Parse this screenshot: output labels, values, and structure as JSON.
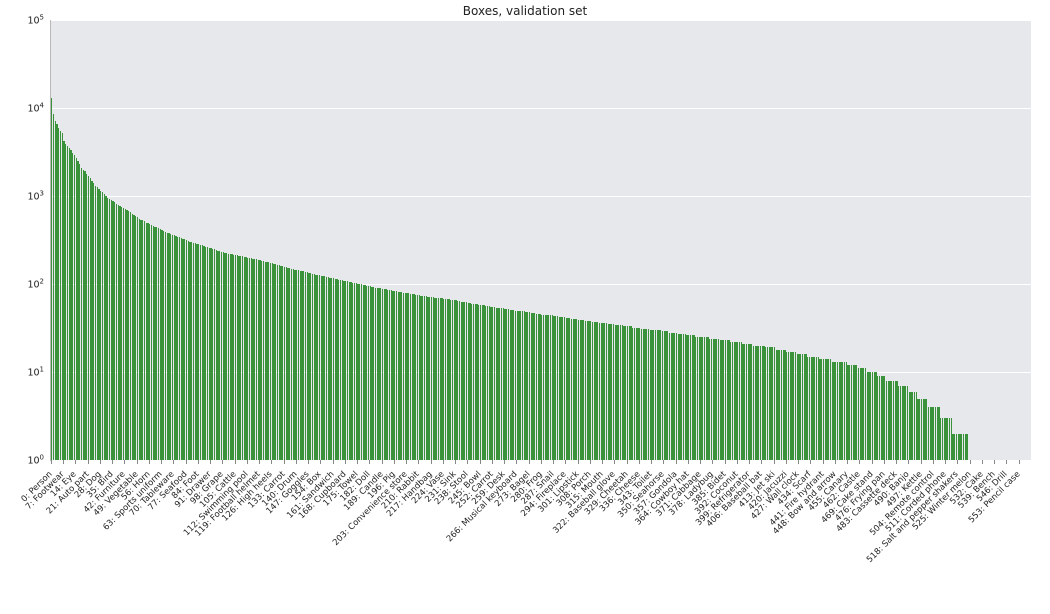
{
  "chart_data": {
    "type": "bar",
    "title": "Boxes, validation set",
    "xlabel": "",
    "ylabel": "",
    "yscale": "log",
    "ylim": [
      1,
      100000
    ],
    "y_ticks": [
      1,
      10,
      100,
      1000,
      10000,
      100000
    ],
    "y_tick_labels": [
      "10⁰",
      "10¹",
      "10²",
      "10³",
      "10⁴",
      "10⁵"
    ],
    "n_bars": 560,
    "bar_color": "#2b8b2b",
    "values": [
      13000,
      8500,
      7200,
      6500,
      6000,
      5500,
      5200,
      4200,
      3900,
      3700,
      3500,
      3300,
      3100,
      2900,
      2700,
      2500,
      2300,
      2100,
      2000,
      1900,
      1800,
      1700,
      1600,
      1500,
      1400,
      1300,
      1250,
      1200,
      1150,
      1100,
      1050,
      1000,
      950,
      920,
      900,
      870,
      850,
      820,
      800,
      770,
      750,
      730,
      710,
      690,
      670,
      650,
      630,
      610,
      590,
      570,
      550,
      540,
      530,
      520,
      500,
      490,
      480,
      470,
      460,
      450,
      440,
      430,
      420,
      410,
      400,
      390,
      382,
      376,
      370,
      364,
      358,
      352,
      346,
      340,
      334,
      328,
      322,
      316,
      310,
      304,
      298,
      294,
      290,
      286,
      282,
      278,
      274,
      270,
      266,
      262,
      258,
      256,
      252,
      248,
      244,
      240,
      236,
      232,
      230,
      226,
      224,
      222,
      220,
      218,
      216,
      214,
      212,
      210,
      208,
      206,
      204,
      202,
      200,
      198,
      196,
      194,
      192,
      190,
      188,
      186,
      184,
      182,
      180,
      178,
      176,
      174,
      172,
      170,
      168,
      166,
      164,
      162,
      160,
      158,
      156,
      154,
      152,
      150,
      148,
      146,
      145,
      143,
      142,
      140,
      139,
      137,
      136,
      134,
      133,
      131,
      130,
      128,
      127,
      126,
      124,
      123,
      122,
      120,
      119,
      118,
      117,
      116,
      115,
      113,
      112,
      111,
      110,
      109,
      108,
      107,
      106,
      105,
      104,
      103,
      102,
      101,
      100,
      99,
      98,
      97,
      96,
      95,
      94,
      93,
      92,
      91,
      91,
      90,
      89,
      88,
      88,
      87,
      86,
      86,
      85,
      84,
      84,
      83,
      82,
      82,
      81,
      80,
      80,
      79,
      79,
      78,
      77,
      77,
      76,
      76,
      75,
      74,
      74,
      73,
      73,
      72,
      72,
      71,
      71,
      70,
      70,
      70,
      69,
      69,
      68,
      68,
      67,
      67,
      66,
      66,
      65,
      65,
      64,
      64,
      63,
      63,
      62,
      62,
      61,
      61,
      60,
      60,
      59,
      59,
      58,
      58,
      57,
      57,
      56,
      56,
      56,
      55,
      55,
      55,
      54,
      54,
      53,
      53,
      53,
      52,
      52,
      52,
      51,
      51,
      51,
      50,
      50,
      50,
      49,
      49,
      49,
      48,
      48,
      48,
      47,
      47,
      47,
      46,
      46,
      46,
      45,
      45,
      45,
      44,
      44,
      44,
      44,
      43,
      43,
      43,
      42,
      42,
      42,
      42,
      41,
      41,
      41,
      40,
      40,
      40,
      40,
      39,
      39,
      39,
      39,
      38,
      38,
      38,
      38,
      37,
      37,
      37,
      37,
      36,
      36,
      36,
      36,
      36,
      35,
      35,
      35,
      35,
      34,
      34,
      34,
      34,
      34,
      33,
      33,
      33,
      33,
      33,
      32,
      32,
      32,
      32,
      32,
      31,
      31,
      31,
      31,
      31,
      30,
      30,
      30,
      30,
      30,
      30,
      30,
      29,
      29,
      29,
      29,
      28,
      28,
      28,
      28,
      28,
      27,
      27,
      27,
      27,
      27,
      26,
      26,
      26,
      26,
      26,
      25,
      25,
      25,
      25,
      25,
      25,
      25,
      25,
      24,
      24,
      24,
      24,
      24,
      24,
      23,
      23,
      23,
      23,
      23,
      23,
      22,
      22,
      22,
      22,
      22,
      22,
      22,
      21,
      21,
      21,
      21,
      21,
      21,
      20,
      20,
      20,
      20,
      20,
      20,
      20,
      19,
      19,
      19,
      19,
      19,
      19,
      18,
      18,
      18,
      18,
      18,
      18,
      17,
      17,
      17,
      17,
      17,
      17,
      16,
      16,
      16,
      16,
      16,
      16,
      15,
      15,
      15,
      15,
      15,
      15,
      15,
      14,
      14,
      14,
      14,
      14,
      14,
      14,
      13,
      13,
      13,
      13,
      13,
      13,
      13,
      13,
      13,
      12,
      12,
      12,
      12,
      12,
      12,
      11,
      11,
      11,
      11,
      11,
      10,
      10,
      10,
      10,
      10,
      10,
      9,
      9,
      9,
      9,
      9,
      8,
      8,
      8,
      8,
      8,
      8,
      8,
      7,
      7,
      7,
      7,
      7,
      7,
      6,
      6,
      6,
      6,
      6,
      5,
      5,
      5,
      5,
      5,
      5,
      4,
      4,
      4,
      4,
      4,
      4,
      4,
      3,
      3,
      3,
      3,
      3,
      3,
      3,
      2,
      2,
      2,
      2,
      2,
      2,
      2,
      2,
      2,
      1,
      1,
      1,
      1,
      1,
      1,
      1,
      1
    ],
    "x_tick_labels": [
      {
        "index": 0,
        "text": "0: Person"
      },
      {
        "index": 7,
        "text": "7: Footwear"
      },
      {
        "index": 14,
        "text": "14: Eye"
      },
      {
        "index": 21,
        "text": "21: Auto part"
      },
      {
        "index": 28,
        "text": "28: Dog"
      },
      {
        "index": 35,
        "text": "35: Bird"
      },
      {
        "index": 42,
        "text": "42: Furniture"
      },
      {
        "index": 49,
        "text": "49: Vegetable"
      },
      {
        "index": 56,
        "text": "56: Horn"
      },
      {
        "index": 63,
        "text": "63: Sports uniform"
      },
      {
        "index": 70,
        "text": "70: Tableware"
      },
      {
        "index": 77,
        "text": "77: Seafood"
      },
      {
        "index": 84,
        "text": "84: Foot"
      },
      {
        "index": 91,
        "text": "91: Drawer"
      },
      {
        "index": 98,
        "text": "98: Grape"
      },
      {
        "index": 105,
        "text": "105: Cattle"
      },
      {
        "index": 112,
        "text": "112: Swimming pool"
      },
      {
        "index": 119,
        "text": "119: Football helmet"
      },
      {
        "index": 126,
        "text": "126: High heels"
      },
      {
        "index": 133,
        "text": "133: Carrot"
      },
      {
        "index": 140,
        "text": "140: Drum"
      },
      {
        "index": 147,
        "text": "147: Goggles"
      },
      {
        "index": 154,
        "text": "154: Box"
      },
      {
        "index": 161,
        "text": "161: Sandwich"
      },
      {
        "index": 168,
        "text": "168: Cupboard"
      },
      {
        "index": 175,
        "text": "175: Towel"
      },
      {
        "index": 182,
        "text": "182: Doll"
      },
      {
        "index": 189,
        "text": "189: Candle"
      },
      {
        "index": 196,
        "text": "196: Pig"
      },
      {
        "index": 203,
        "text": "203: Convenience store"
      },
      {
        "index": 210,
        "text": "210: Rabbit"
      },
      {
        "index": 217,
        "text": "217: Handbag"
      },
      {
        "index": 224,
        "text": "224: Vase"
      },
      {
        "index": 231,
        "text": "231: Sink"
      },
      {
        "index": 238,
        "text": "238: Stool"
      },
      {
        "index": 245,
        "text": "245: Bowl"
      },
      {
        "index": 252,
        "text": "252: Carrot"
      },
      {
        "index": 259,
        "text": "259: Desk"
      },
      {
        "index": 266,
        "text": "266: Musical keyboard"
      },
      {
        "index": 273,
        "text": "273: Bagel"
      },
      {
        "index": 280,
        "text": "280: Frog"
      },
      {
        "index": 287,
        "text": "287: Snail"
      },
      {
        "index": 294,
        "text": "294: Fireplace"
      },
      {
        "index": 301,
        "text": "301: Lipstick"
      },
      {
        "index": 308,
        "text": "308: Porch"
      },
      {
        "index": 315,
        "text": "315: Mouth"
      },
      {
        "index": 322,
        "text": "322: Baseball glove"
      },
      {
        "index": 329,
        "text": "329: Cheetah"
      },
      {
        "index": 336,
        "text": "336: Cheese"
      },
      {
        "index": 343,
        "text": "343: Toilet"
      },
      {
        "index": 350,
        "text": "350: Seahorse"
      },
      {
        "index": 357,
        "text": "357: Gondola"
      },
      {
        "index": 364,
        "text": "364: Cowboy hat"
      },
      {
        "index": 371,
        "text": "371: Cabbage"
      },
      {
        "index": 378,
        "text": "378: Ladybug"
      },
      {
        "index": 385,
        "text": "385: Bidet"
      },
      {
        "index": 392,
        "text": "392: Coconut"
      },
      {
        "index": 399,
        "text": "399: Refrigerator"
      },
      {
        "index": 406,
        "text": "406: Baseball bat"
      },
      {
        "index": 413,
        "text": "413: Jet ski"
      },
      {
        "index": 420,
        "text": "420: Jacuzzi"
      },
      {
        "index": 427,
        "text": "427: Wall clock"
      },
      {
        "index": 434,
        "text": "434: Scarf"
      },
      {
        "index": 441,
        "text": "441: Fire hydrant"
      },
      {
        "index": 448,
        "text": "448: Bow and arrow"
      },
      {
        "index": 455,
        "text": "455: Canary"
      },
      {
        "index": 462,
        "text": "462: Castle"
      },
      {
        "index": 469,
        "text": "469: Cake stand"
      },
      {
        "index": 476,
        "text": "476: Frying pan"
      },
      {
        "index": 483,
        "text": "483: Cassette deck"
      },
      {
        "index": 490,
        "text": "490: Banjo"
      },
      {
        "index": 497,
        "text": "497: Kettle"
      },
      {
        "index": 504,
        "text": "504: Remote control"
      },
      {
        "index": 511,
        "text": "511: Corded phone"
      },
      {
        "index": 518,
        "text": "518: Salt and pepper shakers"
      },
      {
        "index": 525,
        "text": "525: Winter melon"
      },
      {
        "index": 532,
        "text": "532: Cake"
      },
      {
        "index": 539,
        "text": "539: Bench"
      },
      {
        "index": 546,
        "text": "546: Drill"
      },
      {
        "index": 553,
        "text": "553: Pencil case"
      }
    ]
  }
}
